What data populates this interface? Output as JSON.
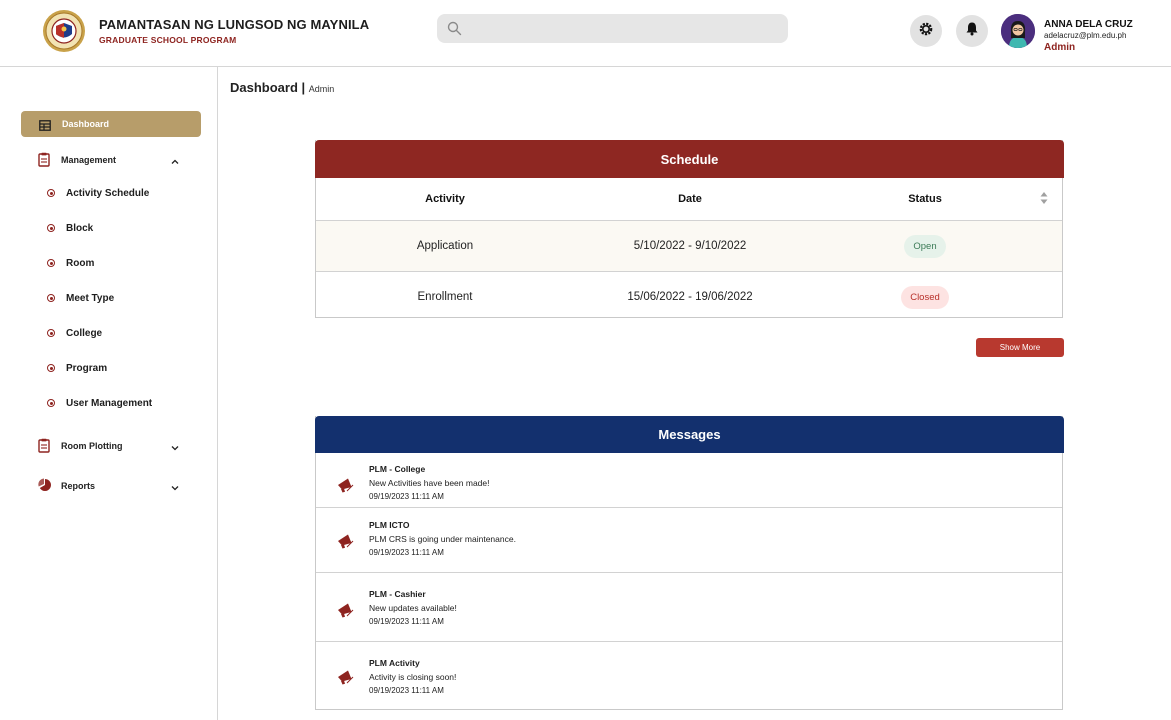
{
  "header": {
    "title": "PAMANTASAN NG LUNGSOD NG MAYNILA",
    "subtitle": "GRADUATE SCHOOL PROGRAM",
    "search": {
      "placeholder": "",
      "value": ""
    },
    "icons": {
      "search": "search-icon",
      "settings": "gear-icon",
      "notifications": "bell-icon"
    },
    "user": {
      "name": "ANNA DELA CRUZ",
      "email": "adelacruz@plm.edu.ph",
      "role": "Admin"
    }
  },
  "sidebar": {
    "active": {
      "label": "Dashboard",
      "icon": "table-icon"
    },
    "management": {
      "label": "Management",
      "icon": "clipboard-icon",
      "expanded": true,
      "items": [
        "Activity Schedule",
        "Block",
        "Room",
        "Meet Type",
        "College",
        "Program",
        "User Management"
      ]
    },
    "room_plotting": {
      "label": "Room Plotting",
      "icon": "clipboard-icon",
      "expanded": false
    },
    "reports": {
      "label": "Reports",
      "icon": "pie-chart-icon",
      "expanded": false
    }
  },
  "page": {
    "title": "Dashboard",
    "crumb": "Admin"
  },
  "schedule": {
    "title": "Schedule",
    "columns": [
      "Activity",
      "Date",
      "Status"
    ],
    "rows": [
      {
        "activity": "Application",
        "date": "5/10/2022 - 9/10/2022",
        "status": "Open"
      },
      {
        "activity": "Enrollment",
        "date": "15/06/2022 - 19/06/2022",
        "status": "Closed"
      }
    ],
    "show_more": "Show More"
  },
  "messages": {
    "title": "Messages",
    "items": [
      {
        "title": "PLM  - College",
        "body": "New Activities have been made!",
        "time": "09/19/2023 11:11 AM"
      },
      {
        "title": "PLM  ICTO",
        "body": "PLM CRS is going under maintenance.",
        "time": "09/19/2023 11:11 AM"
      },
      {
        "title": "PLM - Cashier",
        "body": "New updates available!",
        "time": "09/19/2023 11:11 AM"
      },
      {
        "title": "PLM Activity",
        "body": "Activity is closing soon!",
        "time": "09/19/2023 11:11 AM"
      }
    ]
  },
  "colors": {
    "maroon": "#8e2722",
    "gold": "#b79d6a",
    "navy": "#13306e",
    "open_bg": "#e6f2ea",
    "closed_bg": "#fde3e2"
  }
}
